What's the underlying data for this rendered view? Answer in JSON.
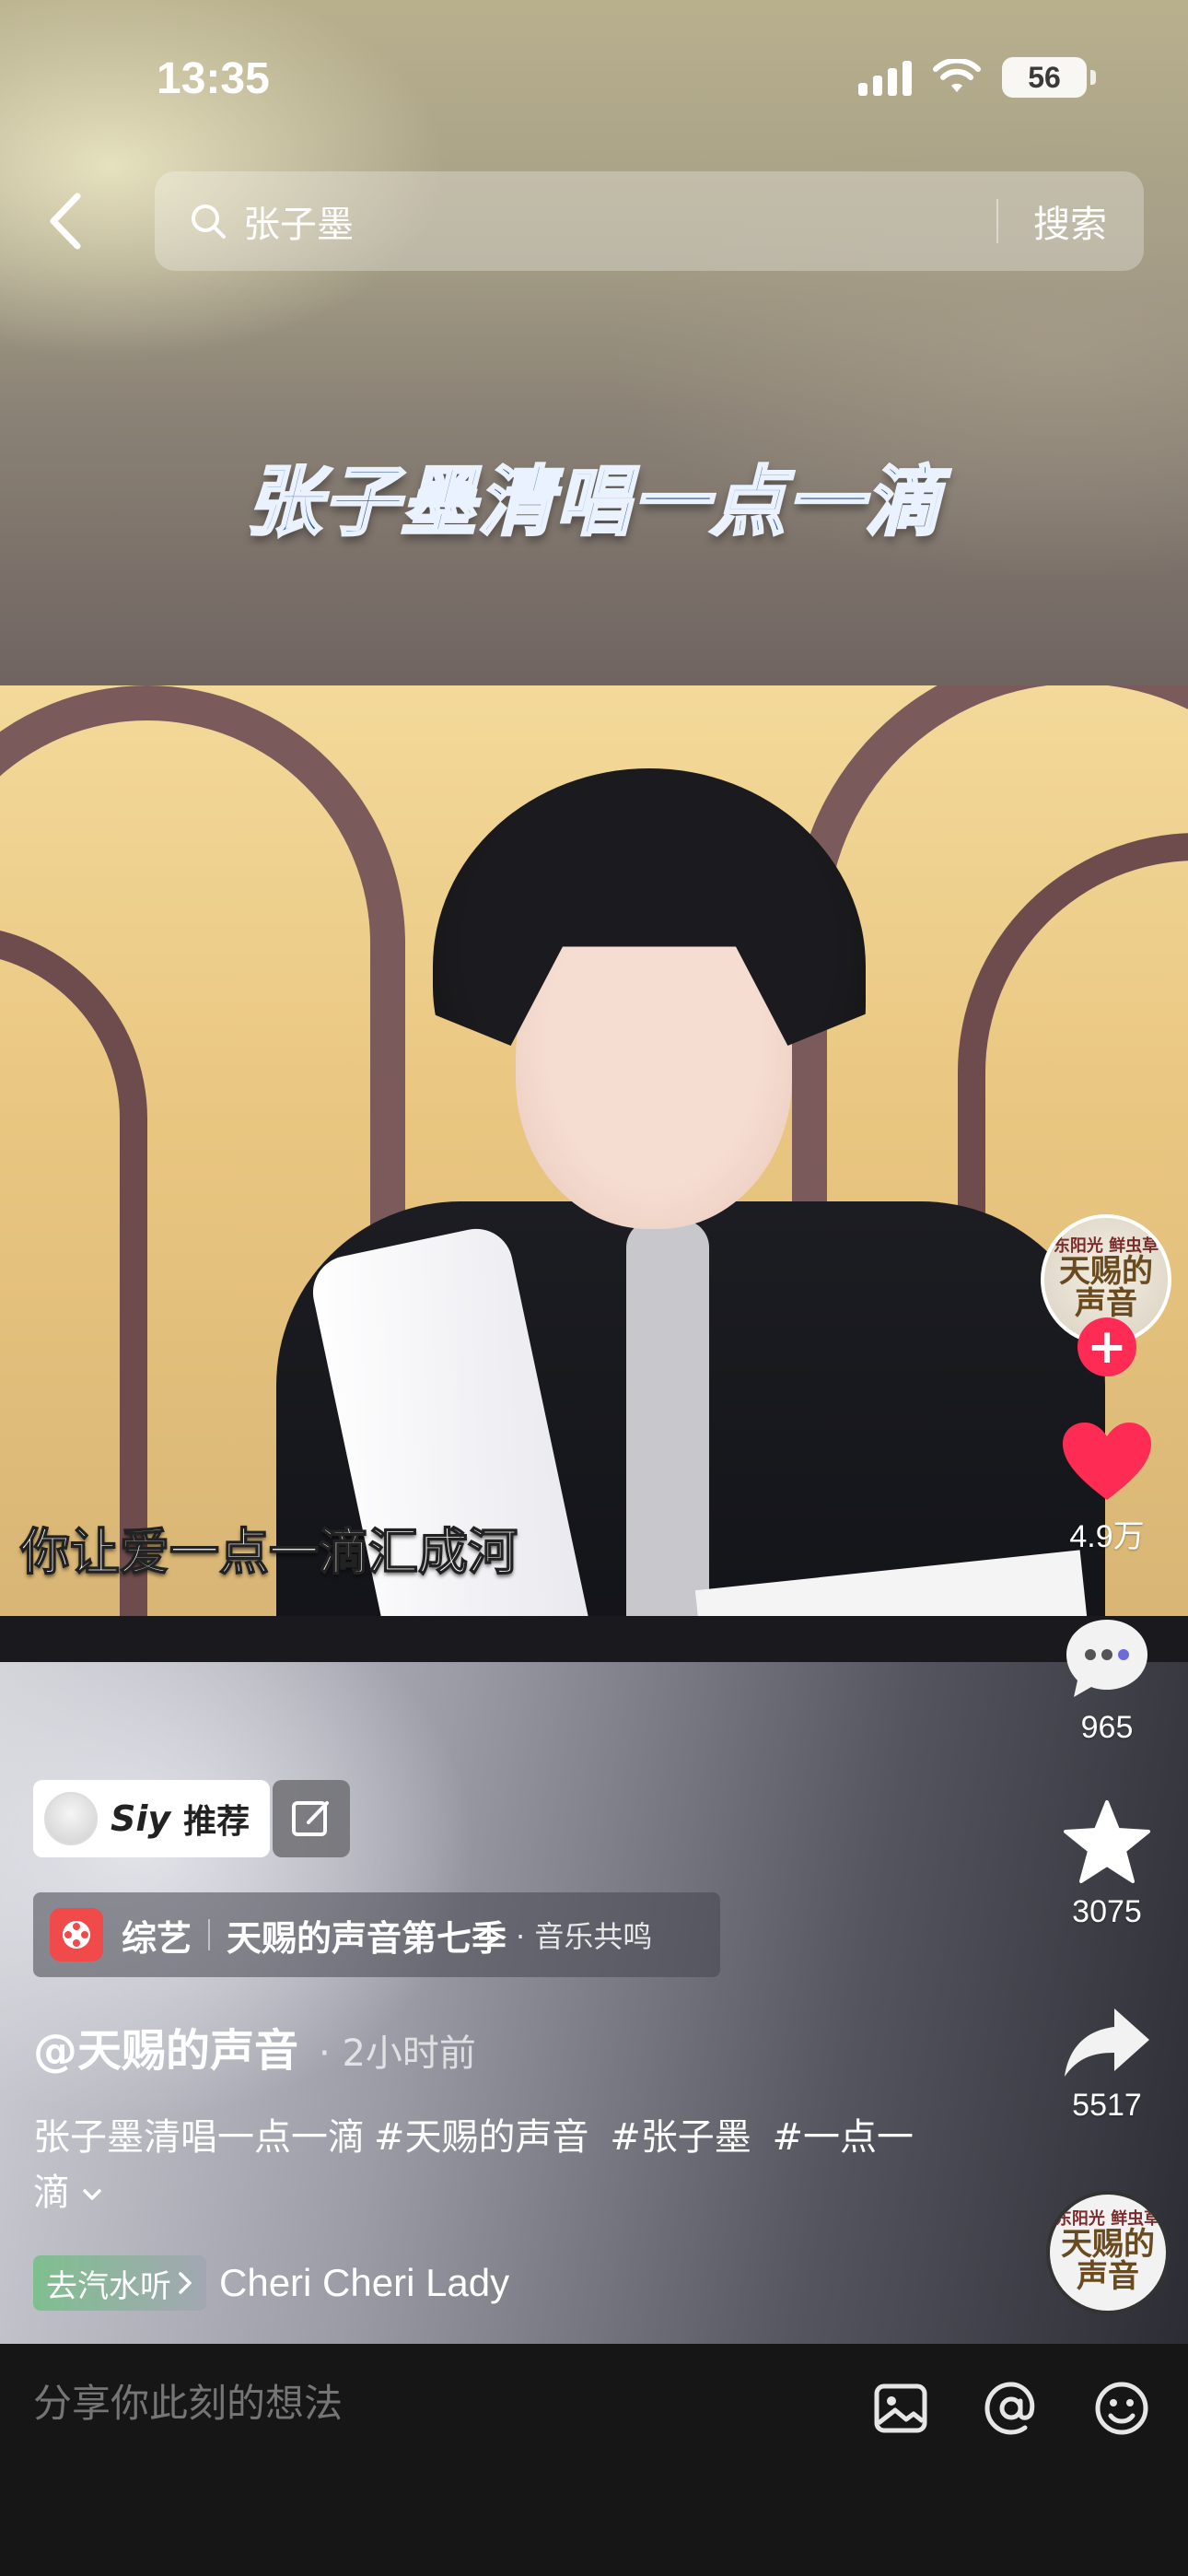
{
  "status_bar": {
    "time": "13:35",
    "battery": "56"
  },
  "search": {
    "query": "张子墨",
    "submit_label": "搜索"
  },
  "video": {
    "title_overlay": "张子墨清唱一点一滴",
    "subtitle": "你让爱一点一滴汇成河",
    "logo_small": "东阳光 鲜虫草",
    "logo_main": "天赐的声音"
  },
  "actions": {
    "likes": "4.9万",
    "comments": "965",
    "favorites": "3075",
    "shares": "5517"
  },
  "recommend": {
    "user": "Siy",
    "label": "推荐"
  },
  "category": {
    "type": "综艺",
    "show": "天赐的声音第七季",
    "sub": "· 音乐共鸣"
  },
  "post": {
    "author": "@天赐的声音",
    "time": "· 2小时前",
    "caption_text": "张子墨清唱一点一滴",
    "hashtags": [
      "#天赐的声音",
      "#张子墨",
      "#一点一滴"
    ]
  },
  "music": {
    "chip_label": "去汽水听",
    "title": "Cheri Cheri Lady"
  },
  "comment_bar": {
    "placeholder": "分享你此刻的想法"
  },
  "colors": {
    "accent": "#fe2c55",
    "title_blue": "#1e4f97"
  }
}
